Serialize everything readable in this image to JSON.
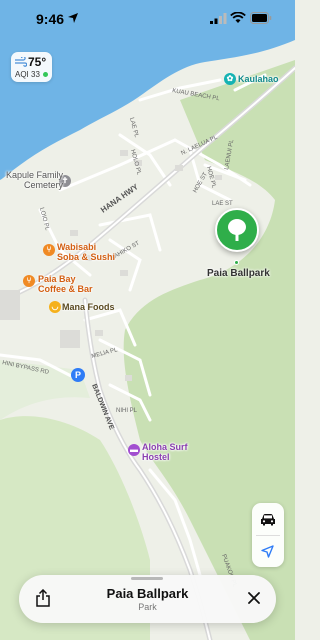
{
  "status_bar": {
    "time": "9:46"
  },
  "weather": {
    "temperature": "75°",
    "aqi": "AQI 33",
    "icon": "wind-icon",
    "aqi_color": "#34c759"
  },
  "map": {
    "streets": {
      "hana_hwy": "HANA HWY",
      "kuau_beach_pl": "KUAU BEACH PL",
      "lae_pl": "LAE PL",
      "holo_pl": "HOLO PL",
      "n_laelua_pl": "N. LAELUA PL",
      "hoe_pl": "HOE PL",
      "laenui_pl": "LAENUI PL",
      "hoe_st": "HOE ST",
      "lae_st": "LAE ST",
      "loio_pl": "LOIO PL",
      "kahiko_st": "KAHIKO ST",
      "melia_pl": "MELIA PL",
      "bypass_rd": "HINI BYPASS RD",
      "baldwin_ave": "BALDWIN AVE",
      "nihi_pl": "NIHI PL",
      "puakou_pl": "PUAKOU PL"
    },
    "pois": {
      "cemetery": "Kapule Family\nCemetery",
      "wabisabi": "Wabisabi\nSoba & Sushi",
      "paia_bay": "Paia Bay\nCoffee & Bar",
      "mana_foods": "Mana Foods",
      "aloha_surf": "Aloha Surf\nHostel",
      "kaulahao": "Kaulahao",
      "parking": "P"
    },
    "selected_place": "Paia Ballpark",
    "colors": {
      "water": "#6fb4e6",
      "land": "#eef0e8",
      "park": "#c9e0b4",
      "road": "#ffffff",
      "highway": "#d8d8d8",
      "selected_pin": "#2fae4a"
    }
  },
  "bottom_sheet": {
    "title": "Paia Ballpark",
    "subtitle": "Park"
  }
}
